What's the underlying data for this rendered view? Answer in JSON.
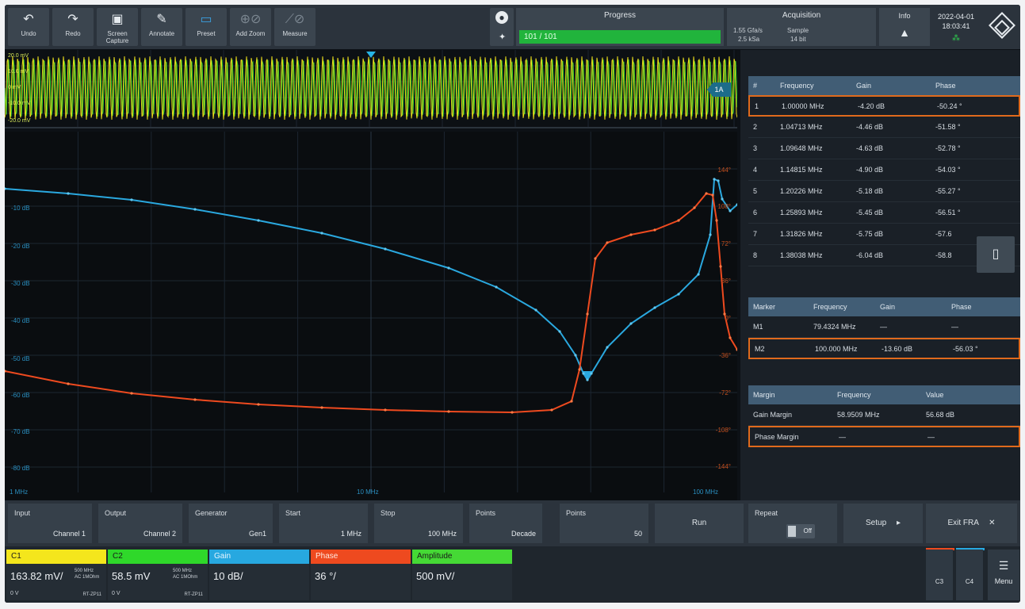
{
  "toolbar": {
    "undo": "Undo",
    "redo": "Redo",
    "screen_capture": "Screen Capture",
    "annotate": "Annotate",
    "preset": "Preset",
    "add_zoom": "Add Zoom",
    "measure": "Measure"
  },
  "progress": {
    "title": "Progress",
    "text": "101 / 101",
    "fraction": 1.0
  },
  "acquisition": {
    "title": "Acquisition",
    "time": "1.55 Gfa/s",
    "rate": "2.5 kSa",
    "sample_label": "Sample",
    "sample_value": "14 bit"
  },
  "info": {
    "label": "Info"
  },
  "datetime": {
    "date": "2022-04-01",
    "time": "18:03:41"
  },
  "overview": {
    "labels": [
      "20.0 mV",
      "10.0 mV",
      "0 mV",
      "-10.0 mV",
      "-20.0 mV"
    ],
    "tag": "1A"
  },
  "plot": {
    "gain_ticks": [
      "-10 dB",
      "-20 dB",
      "-30 dB",
      "-40 dB",
      "-50 dB",
      "-60 dB",
      "-70 dB",
      "-80 dB"
    ],
    "phase_ticks": [
      "144°",
      "108°",
      "72°",
      "36°",
      "0°",
      "-36°",
      "-72°",
      "-108°",
      "-144°"
    ],
    "x_ticks": [
      "1 MHz",
      "10 MHz",
      "100 MHz"
    ]
  },
  "results_table": {
    "headers": [
      "#",
      "Frequency",
      "Gain",
      "Phase"
    ],
    "rows": [
      [
        "1",
        "1.00000 MHz",
        "-4.20 dB",
        "-50.24 °"
      ],
      [
        "2",
        "1.04713 MHz",
        "-4.46 dB",
        "-51.58 °"
      ],
      [
        "3",
        "1.09648 MHz",
        "-4.63 dB",
        "-52.78 °"
      ],
      [
        "4",
        "1.14815 MHz",
        "-4.90 dB",
        "-54.03 °"
      ],
      [
        "5",
        "1.20226 MHz",
        "-5.18 dB",
        "-55.27 °"
      ],
      [
        "6",
        "1.25893 MHz",
        "-5.45 dB",
        "-56.51 °"
      ],
      [
        "7",
        "1.31826 MHz",
        "-5.75 dB",
        "-57.6"
      ],
      [
        "8",
        "1.38038 MHz",
        "-6.04 dB",
        "-58.8"
      ]
    ]
  },
  "marker_table": {
    "headers": [
      "Marker",
      "Frequency",
      "Gain",
      "Phase"
    ],
    "rows": [
      [
        "M1",
        "79.4324 MHz",
        "—",
        "—"
      ],
      [
        "M2",
        "100.000 MHz",
        "-13.60 dB",
        "-56.03 °"
      ]
    ]
  },
  "margin_table": {
    "headers": [
      "Margin",
      "Frequency",
      "Value"
    ],
    "rows": [
      [
        "Gain Margin",
        "58.9509 MHz",
        "56.68 dB"
      ],
      [
        "Phase Margin",
        "—",
        "—"
      ]
    ]
  },
  "settings": {
    "input_label": "Input",
    "input_value": "Channel 1",
    "output_label": "Output",
    "output_value": "Channel 2",
    "generator_label": "Generator",
    "generator_value": "Gen1",
    "start_label": "Start",
    "start_value": "1 MHz",
    "stop_label": "Stop",
    "stop_value": "100 MHz",
    "points_label": "Points",
    "points_value": "Decade",
    "points2_label": "Points",
    "points2_value": "50",
    "run_label": "Run",
    "repeat_label": "Repeat",
    "repeat_value": "Off",
    "setup_label": "Setup",
    "exit_label": "Exit FRA"
  },
  "signals": {
    "c1": {
      "name": "C1",
      "value": "163.82 mV/",
      "bw": "500 MHz",
      "coupling": "AC 1MOhm",
      "offset": "0 V",
      "rdl": "RT-ZP11",
      "color": "#f4e61c"
    },
    "c2": {
      "name": "C2",
      "value": "58.5 mV",
      "bw": "500 MHz",
      "coupling": "AC 1MOhm",
      "offset": "0 V",
      "rdl": "RT-ZP11",
      "color": "#2fd82a"
    },
    "gain": {
      "name": "Gain",
      "value": "10 dB/",
      "color": "#27a8e0"
    },
    "phase": {
      "name": "Phase",
      "value": "36 °/",
      "color": "#ee4a1f"
    },
    "amplitude": {
      "name": "Amplitude",
      "value": "500 mV/",
      "color": "#45d935"
    }
  },
  "bottom": {
    "c3": "C3",
    "c4": "C4",
    "menu": "Menu"
  },
  "colors": {
    "gain": "#2aa8df",
    "phase": "#ee4a1f",
    "accent_orange": "#e06a1c",
    "header_blue": "#415d75"
  }
}
